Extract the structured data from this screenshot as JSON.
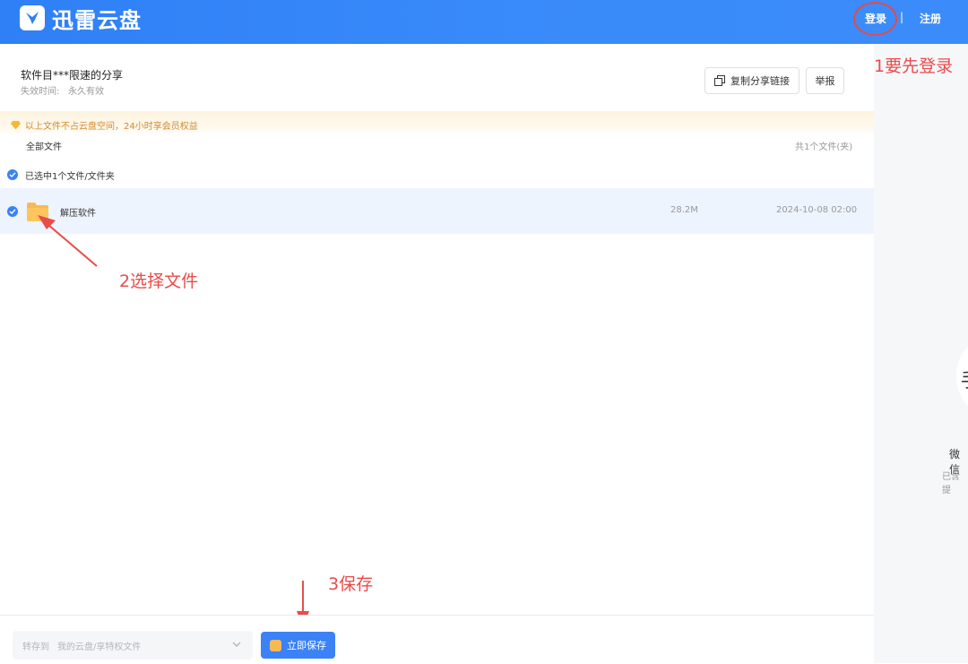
{
  "header": {
    "logo_text": "迅雷云盘",
    "login_label": "登录",
    "separator": "|",
    "register_label": "注册"
  },
  "share": {
    "title": "软件目***限速的分享",
    "expire_label": "失效时间:",
    "expire_value": "永久有效",
    "copy_link_label": "复制分享链接",
    "report_label": "举报"
  },
  "notice": {
    "text": "以上文件不占云盘空间，24小时享会员权益"
  },
  "file_list": {
    "breadcrumb": "全部文件",
    "count_text": "共1个文件(夹)",
    "selected_text": "已选中1个文件/文件夹",
    "files": [
      {
        "name": "解压软件",
        "size": "28.2M",
        "date": "2024-10-08 02:00",
        "selected": true
      }
    ]
  },
  "right_panel": {
    "partial_char": "手",
    "wechat_label": "微信",
    "hint": "已含提"
  },
  "annotations": {
    "step1": "1要先登录",
    "step2": "2选择文件",
    "step3": "3保存"
  },
  "bottom_bar": {
    "save_to_label": "转存到",
    "save_path_placeholder": "我的云盘/享特权文件",
    "save_button_label": "立即保存"
  },
  "colors": {
    "brand_blue": "#3b82f6",
    "annotation_red": "#e94b4b",
    "notice_orange": "#d4892f",
    "folder_yellow": "#f7b955"
  }
}
